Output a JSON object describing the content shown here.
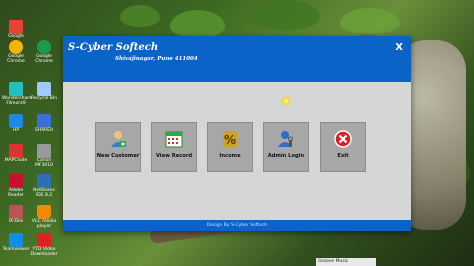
{
  "window": {
    "app_name": "S-Cyber Softech",
    "address": "Shivajinagar, Pune 411004",
    "close_label": "X",
    "footer": "Design By S-Cyber Softech"
  },
  "buttons": [
    {
      "label": "New Customer",
      "icon": "customer-icon"
    },
    {
      "label": "View Record",
      "icon": "calendar-icon"
    },
    {
      "label": "Income",
      "icon": "percent-calculator-icon"
    },
    {
      "label": "Admin Login",
      "icon": "admin-icon"
    },
    {
      "label": "Exit",
      "icon": "exit-icon"
    }
  ],
  "desktop_icons": [
    {
      "label": "Google"
    },
    {
      "label": "Google Chrome"
    },
    {
      "label": "Google Chrome"
    },
    {
      "label": "Wondershare Filmora9"
    },
    {
      "label": "Recycle Bin"
    },
    {
      "label": "HP"
    },
    {
      "label": "SHAREit"
    },
    {
      "label": "MAPClude"
    },
    {
      "label": "Canon MF3010"
    },
    {
      "label": "Adobe Reader"
    },
    {
      "label": "NetBeans IDE 8.2"
    },
    {
      "label": "IX-Dev"
    },
    {
      "label": "VLC media player"
    },
    {
      "label": "Teamviewer"
    },
    {
      "label": "YTD Video Downloader"
    }
  ],
  "taskbar": {
    "tab_label": "Groove Music"
  },
  "colors": {
    "title_blue": "#0a64c8",
    "button_gray": "#a7a7a7",
    "content_gray": "#d6d6d6"
  }
}
